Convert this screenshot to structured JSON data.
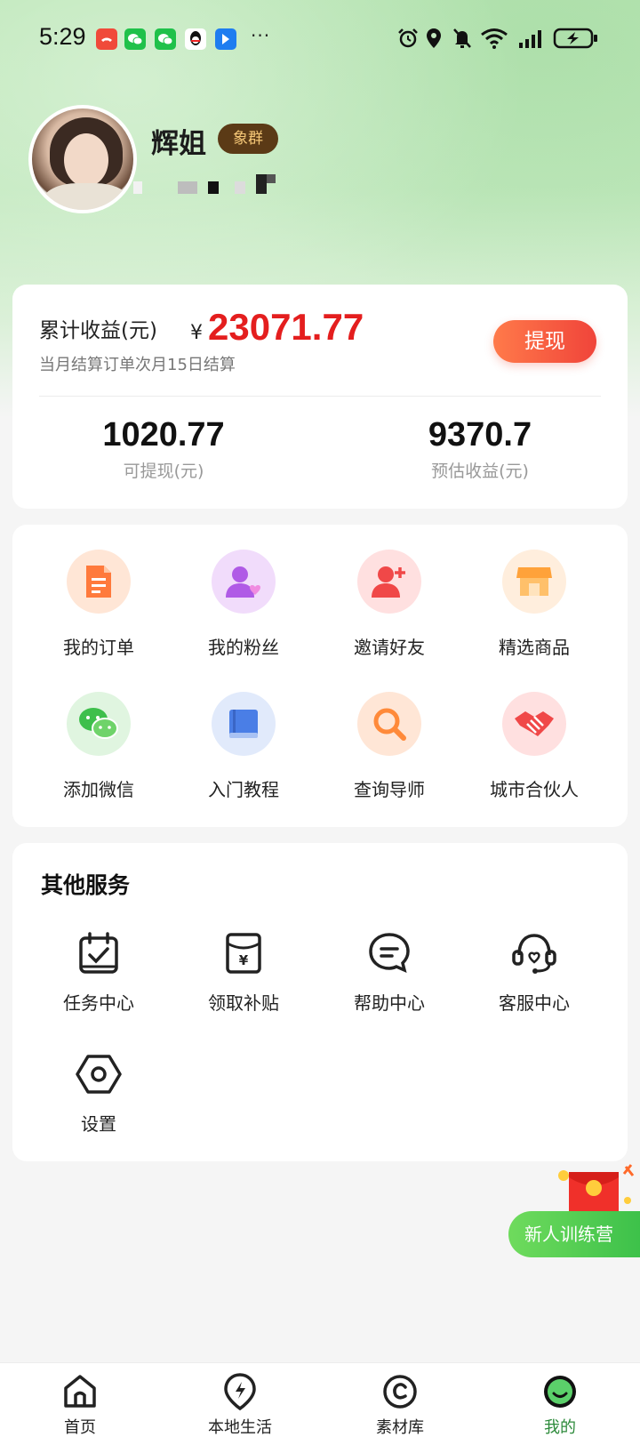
{
  "status_bar": {
    "time": "5:29",
    "more": "···",
    "notification_icons": [
      "missed-call-icon",
      "wechat-icon",
      "wechat-icon",
      "qq-icon",
      "app-icon"
    ],
    "system_icons": [
      "alarm-icon",
      "location-icon",
      "mute-icon",
      "wifi-icon",
      "signal-icon",
      "battery-charging-icon"
    ]
  },
  "profile": {
    "name": "辉姐",
    "badge": "象群"
  },
  "earnings": {
    "label": "累计收益(元)",
    "currency": "¥",
    "total": "23071.77",
    "note": "当月结算订单次月15日结算",
    "withdraw_label": "提现",
    "stats": [
      {
        "value": "1020.77",
        "label": "可提现(元)"
      },
      {
        "value": "9370.7",
        "label": "预估收益(元)"
      }
    ]
  },
  "features": [
    {
      "label": "我的订单",
      "icon": "order-icon",
      "color": "#ff7a3c"
    },
    {
      "label": "我的粉丝",
      "icon": "fans-icon",
      "color": "#b05be6"
    },
    {
      "label": "邀请好友",
      "icon": "invite-friend-icon",
      "color": "#f04848"
    },
    {
      "label": "精选商品",
      "icon": "store-icon",
      "color": "#ffa23a"
    },
    {
      "label": "添加微信",
      "icon": "wechat-icon",
      "color": "#3ebf4c"
    },
    {
      "label": "入门教程",
      "icon": "book-icon",
      "color": "#4a7ee6"
    },
    {
      "label": "查询导师",
      "icon": "search-icon",
      "color": "#ff8a3a"
    },
    {
      "label": "城市合伙人",
      "icon": "handshake-icon",
      "color": "#f04848"
    }
  ],
  "other_services": {
    "title": "其他服务",
    "items": [
      {
        "label": "任务中心",
        "icon": "task-calendar-icon"
      },
      {
        "label": "领取补贴",
        "icon": "subsidy-envelope-icon"
      },
      {
        "label": "帮助中心",
        "icon": "help-chat-icon"
      },
      {
        "label": "客服中心",
        "icon": "customer-service-icon"
      },
      {
        "label": "设置",
        "icon": "settings-hexagon-icon"
      }
    ]
  },
  "floating": {
    "camp_label": "新人训练营"
  },
  "bottom_nav": [
    {
      "label": "首页",
      "icon": "home-icon",
      "active": false
    },
    {
      "label": "本地生活",
      "icon": "lightning-icon",
      "active": false
    },
    {
      "label": "素材库",
      "icon": "material-library-icon",
      "active": false
    },
    {
      "label": "我的",
      "icon": "profile-smile-icon",
      "active": true
    }
  ],
  "colors": {
    "accent_red": "#e41e1e",
    "brand_green": "#3dc14a",
    "badge_brown": "#5b3a16"
  }
}
